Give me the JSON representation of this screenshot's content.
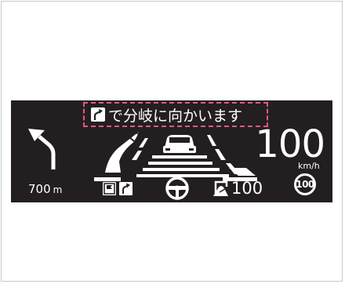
{
  "hud": {
    "guidance_message": "で分岐に向かいます",
    "current_speed": "100",
    "speed_unit": "km/h",
    "speed_limit": "100",
    "distance_value": "700",
    "distance_unit": "m",
    "cruise_set_speed": "100"
  },
  "icons": {
    "message_icon": "branch-right-icon",
    "turn_arrow": "turn-left-arrow-icon",
    "lane_view": "lane-assist-road-icon",
    "lead_vehicle": "lead-car-icon",
    "flag": "destination-flag-icon",
    "branch": "branch-right-icon",
    "steering": "steering-wheel-icon",
    "cruise": "cruise-control-icon"
  },
  "colors": {
    "hud_background": "#231f20",
    "highlight_border": "#e2558f",
    "foreground": "#ffffff"
  }
}
